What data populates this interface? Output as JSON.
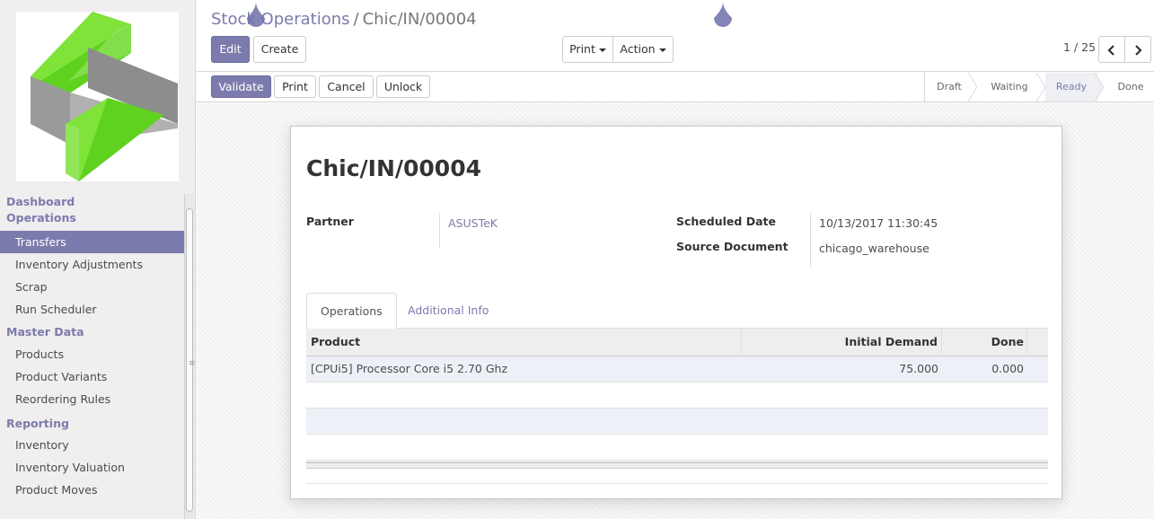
{
  "sidebar": {
    "sections": [
      {
        "title": "Dashboard",
        "items": []
      },
      {
        "title": "Operations",
        "items": [
          "Transfers",
          "Inventory Adjustments",
          "Scrap",
          "Run Scheduler"
        ]
      },
      {
        "title": "Master Data",
        "items": [
          "Products",
          "Product Variants",
          "Reordering Rules"
        ]
      },
      {
        "title": "Reporting",
        "items": [
          "Inventory",
          "Inventory Valuation",
          "Product Moves"
        ]
      }
    ],
    "active_item": "Transfers"
  },
  "breadcrumb": {
    "parent": "Stock Operations",
    "separator": "/",
    "current": "Chic/IN/00004"
  },
  "toolbar": {
    "edit_label": "Edit",
    "create_label": "Create",
    "print_label": "Print",
    "action_label": "Action"
  },
  "pager": {
    "value": "1 / 25"
  },
  "statusbar": {
    "buttons": [
      "Validate",
      "Print",
      "Cancel",
      "Unlock"
    ],
    "stages": [
      "Draft",
      "Waiting",
      "Ready",
      "Done"
    ],
    "active_stage": "Ready"
  },
  "record": {
    "title": "Chic/IN/00004",
    "partner_label": "Partner",
    "partner_value": "ASUSTeK",
    "scheduled_date_label": "Scheduled Date",
    "scheduled_date_value": "10/13/2017 11:30:45",
    "source_document_label": "Source Document",
    "source_document_value": "chicago_warehouse"
  },
  "tabs": [
    "Operations",
    "Additional Info"
  ],
  "grid": {
    "columns": [
      "Product",
      "Initial Demand",
      "Done"
    ],
    "rows": [
      {
        "product": "[CPUi5] Processor Core i5 2.70 Ghz",
        "initial_demand": "75.000",
        "done": "0.000"
      }
    ]
  },
  "colors": {
    "brand": "#7c7bad",
    "logo_green": "#5fcf1f",
    "logo_gray": "#8e8e8e"
  }
}
